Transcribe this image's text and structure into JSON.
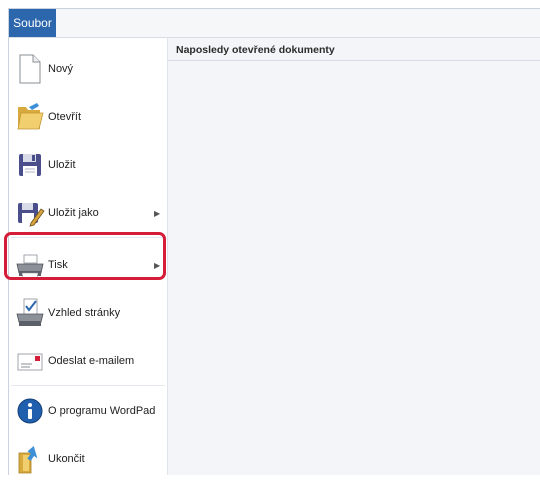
{
  "file_tab": "Soubor",
  "recent_title": "Naposledy otevřené dokumenty",
  "menu": [
    {
      "label": "Nový",
      "icon": "new-document-icon",
      "submenu": false
    },
    {
      "label": "Otevřít",
      "icon": "open-folder-icon",
      "submenu": false
    },
    {
      "label": "Uložit",
      "icon": "save-icon",
      "submenu": false
    },
    {
      "label": "Uložit jako",
      "icon": "save-as-icon",
      "submenu": true
    },
    {
      "label": "Tisk",
      "icon": "printer-icon",
      "submenu": true
    },
    {
      "label": "Vzhled stránky",
      "icon": "page-setup-icon",
      "submenu": false
    },
    {
      "label": "Odeslat e-mailem",
      "icon": "email-icon",
      "submenu": false
    },
    {
      "label": "O programu WordPad",
      "icon": "about-info-icon",
      "submenu": false
    },
    {
      "label": "Ukončit",
      "icon": "exit-icon",
      "submenu": false
    }
  ],
  "colors": {
    "file_tab": "#2c66ad",
    "highlight_border": "#d51c39"
  }
}
